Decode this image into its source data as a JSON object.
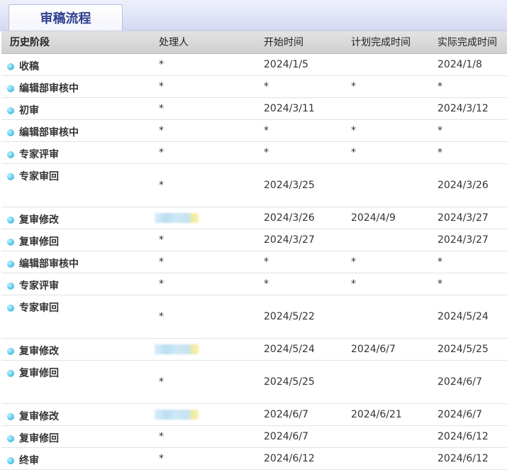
{
  "tab": {
    "title": "审稿流程"
  },
  "table": {
    "headers": {
      "stage": "历史阶段",
      "handler": "处理人",
      "start": "开始时间",
      "planned": "计划完成时间",
      "actual": "实际完成时间"
    },
    "rows": [
      {
        "stage": "收稿",
        "handler": "*",
        "start": "2024/1/5",
        "planned": "",
        "actual": "2024/1/8"
      },
      {
        "stage": "编辑部审核中",
        "handler": "*",
        "start": "*",
        "planned": "*",
        "actual": "*"
      },
      {
        "stage": "初审",
        "handler": "*",
        "start": "2024/3/11",
        "planned": "",
        "actual": "2024/3/12"
      },
      {
        "stage": "编辑部审核中",
        "handler": "*",
        "start": "*",
        "planned": "*",
        "actual": "*"
      },
      {
        "stage": "专家评审",
        "handler": "*",
        "start": "*",
        "planned": "*",
        "actual": "*"
      },
      {
        "stage": "专家审回",
        "handler": "*",
        "start": "2024/3/25",
        "planned": "",
        "actual": "2024/3/26"
      },
      {
        "stage": "复审修改",
        "handler": "",
        "start": "2024/3/26",
        "planned": "2024/4/9",
        "actual": "2024/3/27"
      },
      {
        "stage": "复审修回",
        "handler": "*",
        "start": "2024/3/27",
        "planned": "",
        "actual": "2024/3/27"
      },
      {
        "stage": "编辑部审核中",
        "handler": "*",
        "start": "*",
        "planned": "*",
        "actual": "*"
      },
      {
        "stage": "专家评审",
        "handler": "*",
        "start": "*",
        "planned": "*",
        "actual": "*"
      },
      {
        "stage": "专家审回",
        "handler": "*",
        "start": "2024/5/22",
        "planned": "",
        "actual": "2024/5/24"
      },
      {
        "stage": "复审修改",
        "handler": "",
        "start": "2024/5/24",
        "planned": "2024/6/7",
        "actual": "2024/5/25"
      },
      {
        "stage": "复审修回",
        "handler": "*",
        "start": "2024/5/25",
        "planned": "",
        "actual": "2024/6/7"
      },
      {
        "stage": "复审修改",
        "handler": "",
        "start": "2024/6/7",
        "planned": "2024/6/21",
        "actual": "2024/6/7"
      },
      {
        "stage": "复审修回",
        "handler": "*",
        "start": "2024/6/7",
        "planned": "",
        "actual": "2024/6/12"
      },
      {
        "stage": "终审",
        "handler": "*",
        "start": "2024/6/12",
        "planned": "",
        "actual": "2024/6/12"
      }
    ]
  },
  "colors": {
    "tab_text": "#2f3f8f",
    "header_bg": "#d6d6d6",
    "bullet": "#5cc9ea",
    "row_divider": "#e2e2e2"
  },
  "icons": {
    "row_bullet": "status-bullet-icon"
  }
}
